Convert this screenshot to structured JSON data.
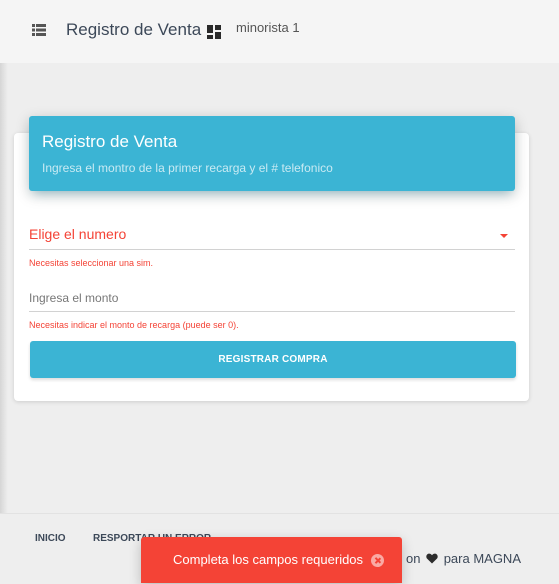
{
  "navbar": {
    "menu_icon": "list-icon",
    "title": "Registro de Venta",
    "dashboard_icon": "dashboard-icon",
    "user": "minorista 1"
  },
  "card": {
    "title": "Registro de Venta",
    "subtitle": "Ingresa el montro de la primer recarga y el # telefonico",
    "accent_color": "#3bb4d4"
  },
  "form": {
    "number_select": {
      "value": "Elige el numero",
      "error": "Necesitas seleccionar una sim."
    },
    "amount_input": {
      "placeholder": "Ingresa el monto",
      "value": "",
      "error": "Necesitas indicar el monto de recarga (puede ser 0)."
    },
    "submit_label": "REGISTRAR COMPRA",
    "error_color": "#f44336"
  },
  "footer": {
    "links": [
      {
        "label": "INICIO"
      },
      {
        "label": "RESPORTAR UN ERROR"
      }
    ],
    "credit_prefix": "on",
    "heart_icon": "heart-icon",
    "credit_suffix": "para MAGNA"
  },
  "toast": {
    "message": "Completa los campos requeridos",
    "close_icon": "close-circle-icon"
  }
}
